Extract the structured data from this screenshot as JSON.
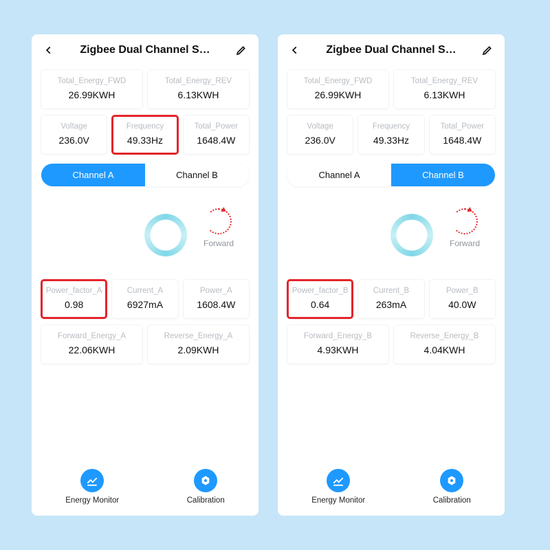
{
  "screens": [
    {
      "title": "Zigbee Dual Channel S…",
      "energy": {
        "fwd_lbl": "Total_Energy_FWD",
        "fwd_val": "26.99KWH",
        "rev_lbl": "Total_Energy_REV",
        "rev_val": "6.13KWH"
      },
      "triple": {
        "voltage_lbl": "Voltage",
        "voltage_val": "236.0V",
        "freq_lbl": "Frequency",
        "freq_val": "49.33Hz",
        "freq_red": true,
        "power_lbl": "Total_Power",
        "power_val": "1648.4W"
      },
      "tabs": {
        "a": "Channel A",
        "b": "Channel B",
        "active": "a"
      },
      "forward_label": "Forward",
      "row3": {
        "pf_lbl": "Power_factor_A",
        "pf_val": "0.98",
        "pf_red": true,
        "cur_lbl": "Current_A",
        "cur_val": "6927mA",
        "pow_lbl": "Power_A",
        "pow_val": "1608.4W"
      },
      "row4": {
        "fwd_lbl": "Forward_Energy_A",
        "fwd_val": "22.06KWH",
        "rev_lbl": "Reverse_Energy_A",
        "rev_val": "2.09KWH"
      },
      "nav": {
        "monitor": "Energy Monitor",
        "calibration": "Calibration"
      }
    },
    {
      "title": "Zigbee Dual Channel S…",
      "energy": {
        "fwd_lbl": "Total_Energy_FWD",
        "fwd_val": "26.99KWH",
        "rev_lbl": "Total_Energy_REV",
        "rev_val": "6.13KWH"
      },
      "triple": {
        "voltage_lbl": "Voltage",
        "voltage_val": "236.0V",
        "freq_lbl": "Frequency",
        "freq_val": "49.33Hz",
        "freq_red": false,
        "power_lbl": "Total_Power",
        "power_val": "1648.4W"
      },
      "tabs": {
        "a": "Channel A",
        "b": "Channel B",
        "active": "b"
      },
      "forward_label": "Forward",
      "row3": {
        "pf_lbl": "Power_factor_B",
        "pf_val": "0.64",
        "pf_red": true,
        "cur_lbl": "Current_B",
        "cur_val": "263mA",
        "pow_lbl": "Power_B",
        "pow_val": "40.0W"
      },
      "row4": {
        "fwd_lbl": "Forward_Energy_B",
        "fwd_val": "4.93KWH",
        "rev_lbl": "Reverse_Energy_B",
        "rev_val": "4.04KWH"
      },
      "nav": {
        "monitor": "Energy Monitor",
        "calibration": "Calibration"
      }
    }
  ]
}
